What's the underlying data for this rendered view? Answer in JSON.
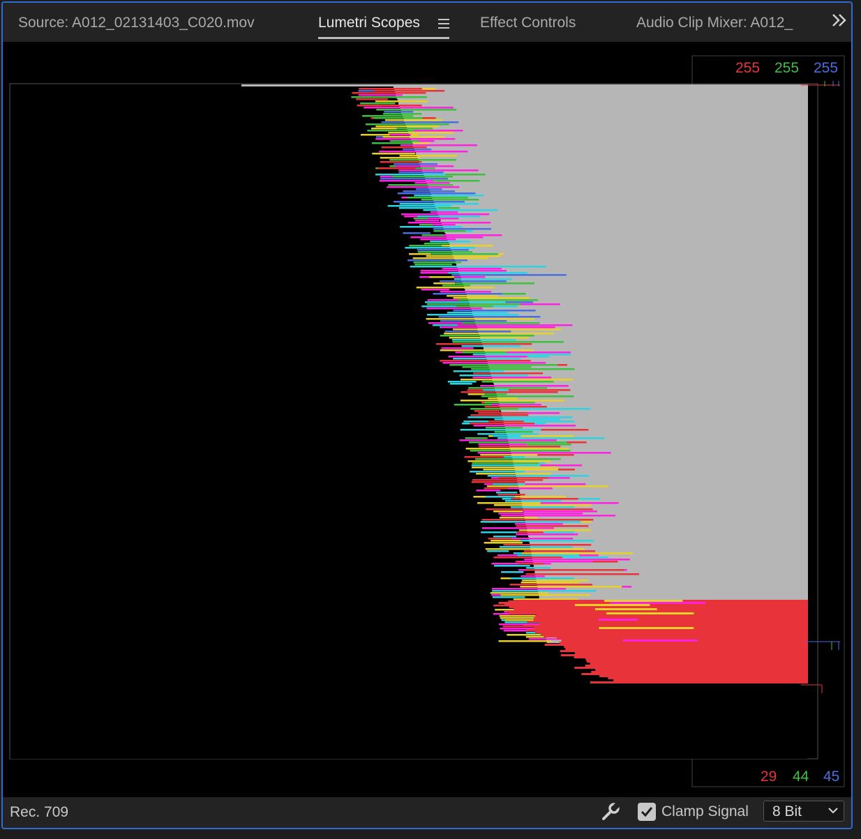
{
  "tabs": [
    {
      "label": "Source: A012_02131403_C020.mov",
      "active": false
    },
    {
      "label": "Lumetri Scopes",
      "active": true
    },
    {
      "label": "Effect Controls",
      "active": false
    },
    {
      "label": "Audio Clip Mixer: A012_",
      "active": false
    }
  ],
  "icons": {
    "tab_menu": "hamburger-menu-icon",
    "overflow": "double-chevron-right-icon",
    "settings": "wrench-icon",
    "dropdown": "chevron-down-icon"
  },
  "scope": {
    "type": "Parade RGB histogram",
    "max": {
      "r": "255",
      "g": "255",
      "b": "255"
    },
    "min": {
      "r": "29",
      "g": "44",
      "b": "45"
    },
    "colors": {
      "red": "#e8333a",
      "green": "#3fbf3f",
      "blue": "#4a6ee0",
      "cyan": "#2bd3e3",
      "magenta": "#ff21e0",
      "yellow": "#e8d02a",
      "white": "#b6b6b6"
    }
  },
  "footer": {
    "color_space": "Rec. 709",
    "clamp_label": "Clamp Signal",
    "clamp_checked": true,
    "bit_depth": "8 Bit"
  },
  "colors": {
    "accent_border": "#2f6bd1",
    "panel_bg": "#232323"
  }
}
